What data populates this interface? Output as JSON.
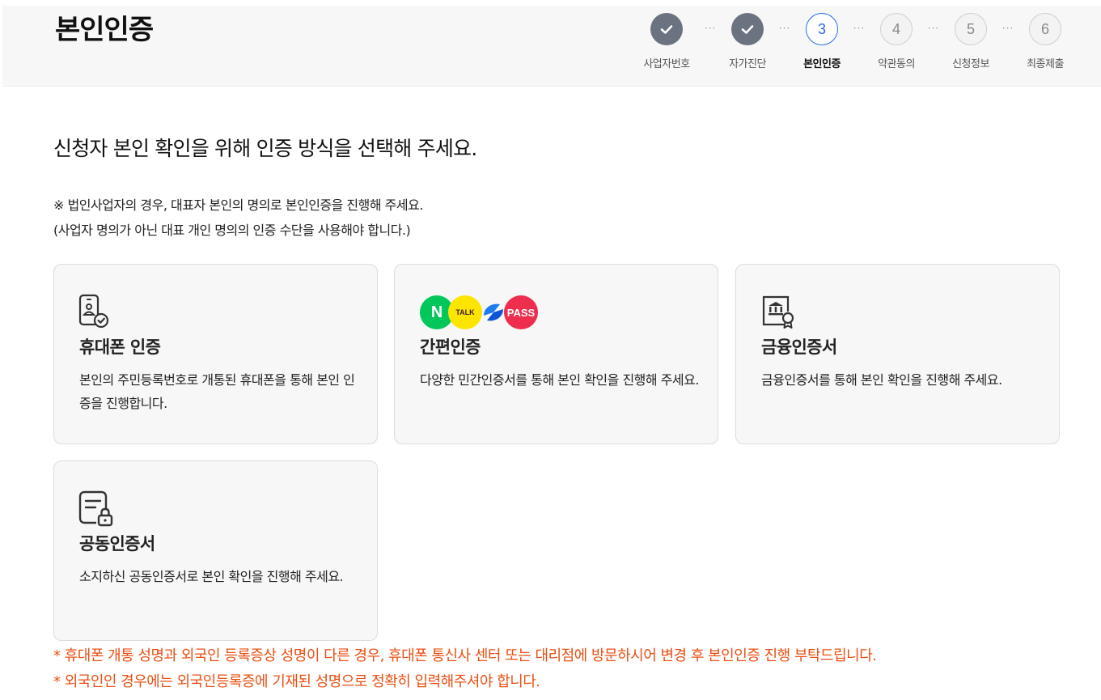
{
  "header": {
    "title": "본인인증",
    "steps": [
      {
        "label": "사업자번호",
        "number": "1",
        "state": "done"
      },
      {
        "label": "자가진단",
        "number": "2",
        "state": "done"
      },
      {
        "label": "본인인증",
        "number": "3",
        "state": "current"
      },
      {
        "label": "약관동의",
        "number": "4",
        "state": "todo"
      },
      {
        "label": "신청정보",
        "number": "5",
        "state": "todo"
      },
      {
        "label": "최종제출",
        "number": "6",
        "state": "todo"
      }
    ],
    "step_separator": "···"
  },
  "main": {
    "intro": "신청자 본인 확인을 위해 인증 방식을 선택해 주세요.",
    "note_line1": "※ 법인사업자의 경우, 대표자 본인의 명의로 본인인증을 진행해 주세요.",
    "note_line2": "(사업자 명의가 아닌 대표 개인 명의의 인증 수단을 사용해야 합니다.)",
    "cards": [
      {
        "title": "휴대폰 인증",
        "desc": "본인의 주민등록번호로 개통된 휴대폰을 통해 본인 인증을 진행합니다.",
        "icon": "phone-check-icon"
      },
      {
        "title": "간편인증",
        "desc": "다양한 민간인증서를 통해 본인 확인을 진행해 주세요.",
        "icon": "simple-auth-logos",
        "logos": {
          "naver": "N",
          "kakao": "TALK",
          "pass": "PASS"
        }
      },
      {
        "title": "금융인증서",
        "desc": "금융인증서를 통해 본인 확인을 진행해 주세요.",
        "icon": "bank-certificate-icon"
      },
      {
        "title": "공동인증서",
        "desc": "소지하신 공동인증서로 본인 확인을 진행해 주세요.",
        "icon": "document-lock-icon"
      }
    ],
    "warnings": [
      "* 휴대폰 개통 성명과 외국인 등록증상 성명이 다른 경우, 휴대폰 통신사 센터 또는 대리점에 방문하시어 변경 후 본인인증 진행 부탁드립니다.",
      "* 외국인인 경우에는 외국인등록증에 기재된 성명으로 정확히 입력해주셔야 합니다."
    ]
  },
  "colors": {
    "step_done": "#6b7280",
    "step_current": "#2a6be6",
    "warning": "#ea4f12",
    "naver": "#03c75a",
    "kakao": "#fee500",
    "pass": "#ee2e4e"
  }
}
